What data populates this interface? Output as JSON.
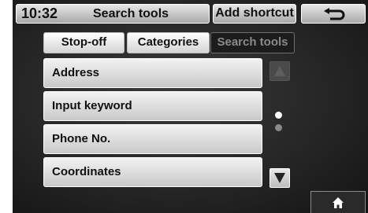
{
  "header": {
    "time": "10:32",
    "title": "Search tools",
    "add_shortcut_label": "Add shortcut",
    "back_icon": "back-arrow-icon"
  },
  "tabs": [
    {
      "label": "Stop-off",
      "active": true
    },
    {
      "label": "Categories",
      "active": true
    },
    {
      "label": "Search tools",
      "active": false
    }
  ],
  "list": {
    "items": [
      {
        "label": "Address"
      },
      {
        "label": "Input keyword"
      },
      {
        "label": "Phone No."
      },
      {
        "label": "Coordinates"
      }
    ]
  },
  "scroll": {
    "up_enabled": false,
    "down_enabled": true,
    "pages": 2,
    "current_page": 1
  },
  "footer": {
    "home_icon": "home-icon"
  },
  "colors": {
    "background": "#262626",
    "button_light": "#e0e0e0",
    "text_dark": "#111111"
  }
}
